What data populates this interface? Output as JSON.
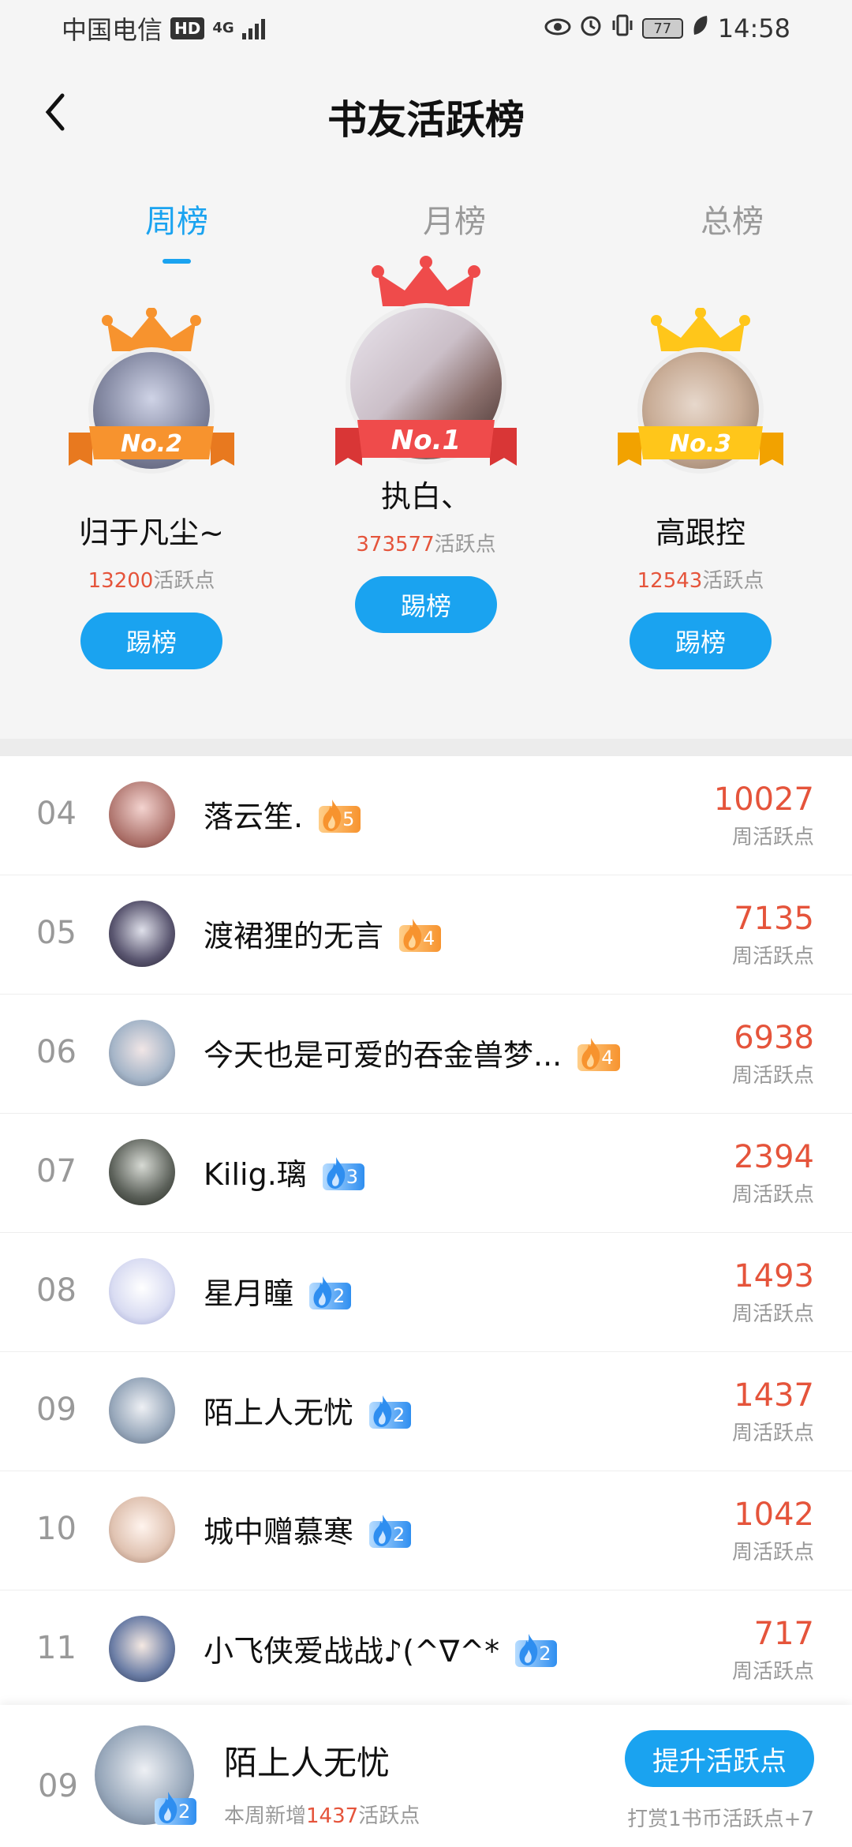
{
  "status_bar": {
    "carrier": "中国电信",
    "hd": "HD",
    "network": "4G",
    "battery": "77",
    "time": "14:58"
  },
  "header": {
    "title": "书友活跃榜"
  },
  "tabs": [
    {
      "label": "周榜",
      "active": true
    },
    {
      "label": "月榜",
      "active": false
    },
    {
      "label": "总榜",
      "active": false
    }
  ],
  "podium": {
    "first": {
      "badge": "No.1",
      "name": "执白、",
      "score": "373577",
      "unit": "活跃点",
      "button": "踢榜"
    },
    "second": {
      "badge": "No.2",
      "name": "归于凡尘~",
      "score": "13200",
      "unit": "活跃点",
      "button": "踢榜"
    },
    "third": {
      "badge": "No.3",
      "name": "高跟控",
      "score": "12543",
      "unit": "活跃点",
      "button": "踢榜"
    }
  },
  "list": [
    {
      "rank": "04",
      "name": "落云笙.",
      "level": "5",
      "level_color": "orange",
      "score": "10027",
      "unit": "周活跃点"
    },
    {
      "rank": "05",
      "name": "渡裙狸的无言",
      "level": "4",
      "level_color": "orange",
      "score": "7135",
      "unit": "周活跃点"
    },
    {
      "rank": "06",
      "name": "今天也是可爱的吞金兽梦...",
      "level": "4",
      "level_color": "orange",
      "score": "6938",
      "unit": "周活跃点"
    },
    {
      "rank": "07",
      "name": "Kilig.璃",
      "level": "3",
      "level_color": "blue",
      "score": "2394",
      "unit": "周活跃点"
    },
    {
      "rank": "08",
      "name": "星月瞳",
      "level": "2",
      "level_color": "blue",
      "score": "1493",
      "unit": "周活跃点"
    },
    {
      "rank": "09",
      "name": "陌上人无忧",
      "level": "2",
      "level_color": "blue",
      "score": "1437",
      "unit": "周活跃点"
    },
    {
      "rank": "10",
      "name": "城中赠慕寒",
      "level": "2",
      "level_color": "blue",
      "score": "1042",
      "unit": "周活跃点"
    },
    {
      "rank": "11",
      "name": "小飞侠爱战战♪(^∇^*",
      "level": "2",
      "level_color": "blue",
      "score": "717",
      "unit": "周活跃点"
    }
  ],
  "me": {
    "rank": "09",
    "name": "陌上人无忧",
    "level": "2",
    "sub_prefix": "本周新增",
    "sub_value": "1437",
    "sub_suffix": "活跃点",
    "button": "提升活跃点",
    "hint": "打赏1书币活跃点+7"
  },
  "colors": {
    "accent": "#1aa3f0",
    "score_red": "#e5543b",
    "gold": "#ffc61a",
    "silver_orange": "#f7932e",
    "first_red": "#ef4b4b"
  }
}
